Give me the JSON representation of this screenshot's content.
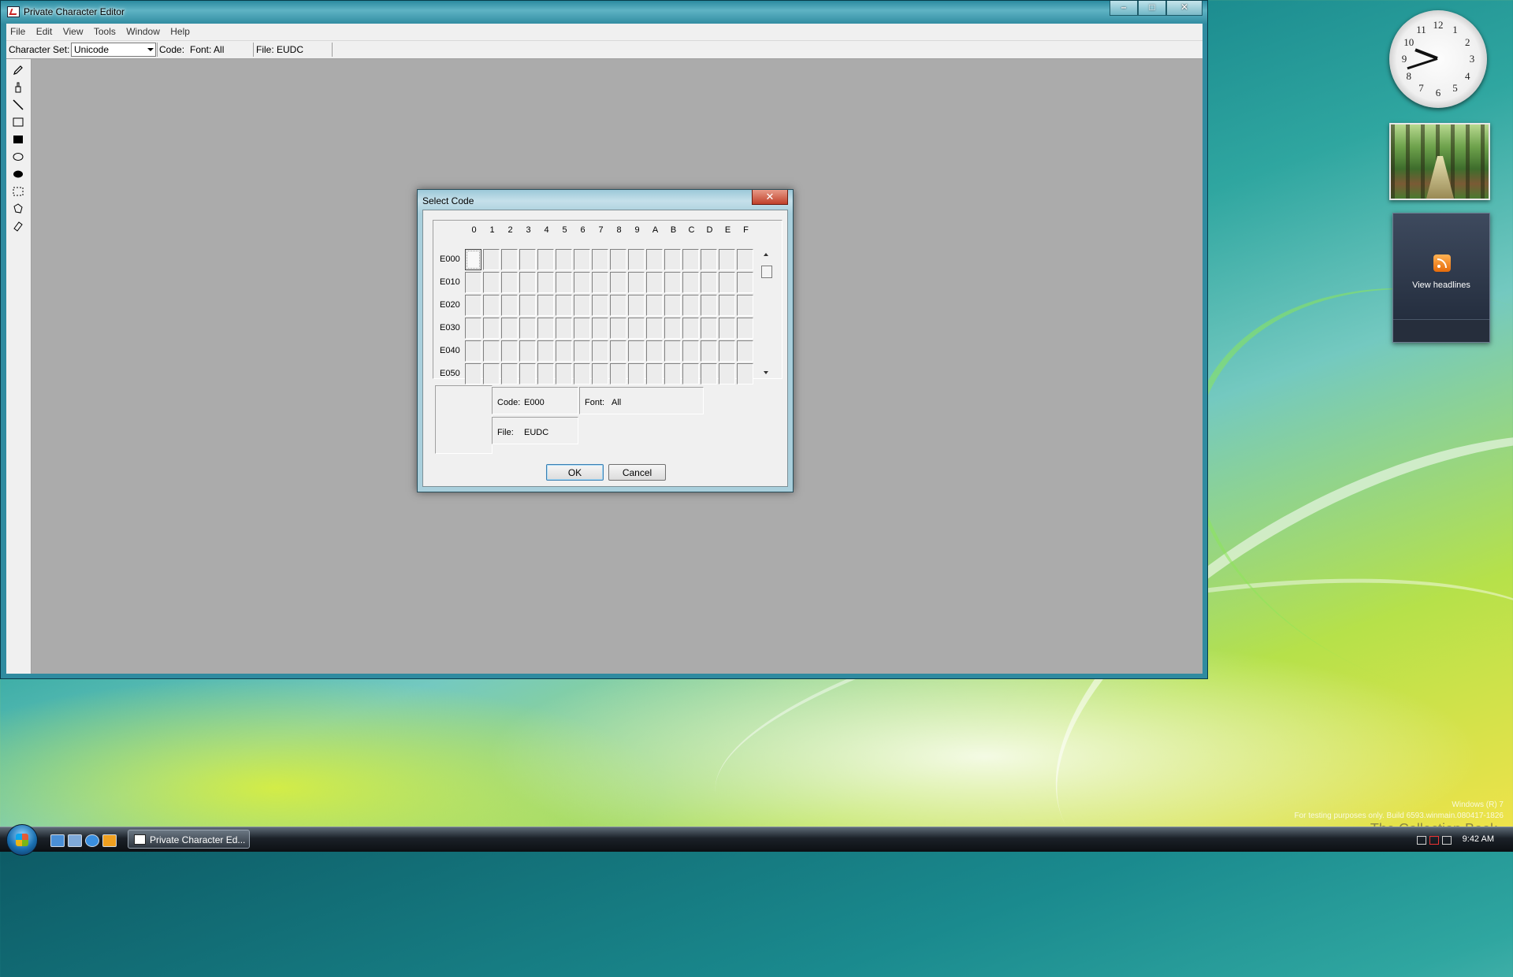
{
  "window": {
    "title": "Private Character Editor",
    "caption_buttons": {
      "minimize": "–",
      "maximize": "□",
      "close": "✕"
    }
  },
  "menu": [
    "File",
    "Edit",
    "View",
    "Tools",
    "Window",
    "Help"
  ],
  "toolbar": {
    "charset_label": "Character Set:",
    "charset_value": "Unicode",
    "code_label": "Code:",
    "font_label": "Font: All",
    "file_label": "File: EUDC"
  },
  "tools": [
    "pencil-icon",
    "brush-icon",
    "line-icon",
    "hollow-rectangle-icon",
    "filled-rectangle-icon",
    "hollow-ellipse-icon",
    "filled-ellipse-icon",
    "rect-select-icon",
    "freeform-select-icon",
    "eraser-icon"
  ],
  "dialog": {
    "title": "Select Code",
    "close": "✕",
    "columns": [
      "0",
      "1",
      "2",
      "3",
      "4",
      "5",
      "6",
      "7",
      "8",
      "9",
      "A",
      "B",
      "C",
      "D",
      "E",
      "F"
    ],
    "rows": [
      "E000",
      "E010",
      "E020",
      "E030",
      "E040",
      "E050"
    ],
    "selected": {
      "row": "E000",
      "col": "0"
    },
    "code_key": "Code:",
    "code_value": "E000",
    "font_key": "Font:",
    "font_value": "All",
    "file_key": "File:",
    "file_value": "EUDC",
    "ok": "OK",
    "cancel": "Cancel"
  },
  "gadgets": {
    "clock": {
      "numbers": [
        "12",
        "1",
        "2",
        "3",
        "4",
        "5",
        "6",
        "7",
        "8",
        "9",
        "10",
        "11"
      ],
      "hour": 9,
      "minute": 42
    },
    "feed_label": "View headlines"
  },
  "taskbar": {
    "task_label": "Private Character Ed...",
    "time": "9:42 AM"
  },
  "desktop": {
    "watermark_line1": "Windows (R) 7",
    "watermark_line2": "For testing purposes only. Build 6593.winmain.080417-1826",
    "collection": "The Collection Book"
  },
  "colors": {
    "workarea": "#ababab",
    "titlebar": "#5fb3c4",
    "dialog_close": "#c0412a"
  }
}
